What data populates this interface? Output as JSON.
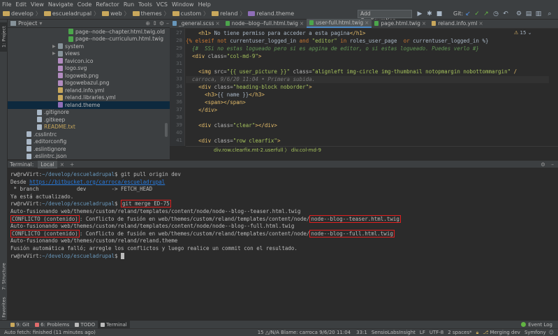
{
  "menu": [
    "File",
    "Edit",
    "View",
    "Navigate",
    "Code",
    "Refactor",
    "Run",
    "Tools",
    "VCS",
    "Window",
    "Help"
  ],
  "breadcrumb": [
    "develop",
    "escueladrupal",
    "web",
    "themes",
    "custom",
    "reland",
    "reland.theme"
  ],
  "toolbar": {
    "add_configuration": "Add Configuration...",
    "git_label": "Git:"
  },
  "project": {
    "header": "Project",
    "tree": [
      {
        "label": "page--node--chapter.html.twig.old",
        "indent": 5,
        "kind": "twig"
      },
      {
        "label": "page--node--curriculum.html.twig",
        "indent": 5,
        "kind": "twig"
      },
      {
        "label": "system",
        "indent": 4,
        "kind": "folder",
        "arrow": "▶"
      },
      {
        "label": "views",
        "indent": 4,
        "kind": "folder",
        "arrow": "▶"
      },
      {
        "label": "favicon.ico",
        "indent": 4,
        "kind": "img"
      },
      {
        "label": "logo.svg",
        "indent": 4,
        "kind": "img"
      },
      {
        "label": "logoweb.png",
        "indent": 4,
        "kind": "img"
      },
      {
        "label": "logowebazul.png",
        "indent": 4,
        "kind": "img"
      },
      {
        "label": "reland.info.yml",
        "indent": 4,
        "kind": "yml"
      },
      {
        "label": "reland.libraries.yml",
        "indent": 4,
        "kind": "yml"
      },
      {
        "label": "reland.theme",
        "indent": 4,
        "kind": "php",
        "selected": true
      },
      {
        "label": ".gitignore",
        "indent": 2,
        "kind": "txt"
      },
      {
        "label": ".gitkeep",
        "indent": 2,
        "kind": "txt"
      },
      {
        "label": "README.txt",
        "indent": 2,
        "kind": "readme"
      },
      {
        "label": ".csslintrc",
        "indent": 1,
        "kind": "txt"
      },
      {
        "label": ".editorconfig",
        "indent": 1,
        "kind": "cfg"
      },
      {
        "label": ".eslintignore",
        "indent": 1,
        "kind": "cfg"
      },
      {
        "label": ".eslintrc.json",
        "indent": 1,
        "kind": "cfg"
      }
    ]
  },
  "tabs": [
    {
      "label": "_general.scss",
      "color": "#6897bb"
    },
    {
      "label": "node--blog--full.html.twig",
      "color": "#4ca64c"
    },
    {
      "label": "user-full.html.twig",
      "color": "#4ca64c",
      "active": true
    },
    {
      "label": "page.html.twig",
      "color": "#4ca64c"
    },
    {
      "label": "reland.info.yml",
      "color": "#c9a85c"
    }
  ],
  "editor": {
    "lines": [
      {
        "n": "27",
        "html": "    <span class='c-tag'>&lt;h1&gt;</span><span class='c-txt'> No tiene permiso para acceder a esta pagina</span><span class='c-tag'>&lt;/h1&gt;</span>"
      },
      {
        "n": "28",
        "html": "<span class='c-kw'>{% elseif not</span><span class='c-txt'> currentuser_logged_in </span><span class='c-kw'>and</span><span class='c-str'> \"editor\"</span><span class='c-kw'> in</span><span class='c-txt'> roles_user_page  </span><span class='c-kw'>or</span><span class='c-txt'> currentuser_logged_in %}</span>"
      },
      {
        "n": "29",
        "html": "  <span class='c-com'>{#  SSi no estas logueado pero si es apgina de editor, o si estas logueado. Puedes verlo #}</span>"
      },
      {
        "n": "30",
        "html": "  <span class='c-tag'>&lt;div </span><span class='c-attr'>class=</span><span class='c-str'>\"col-md-9\"</span><span class='c-tag'>&gt;</span>"
      },
      {
        "n": "31",
        "html": ""
      },
      {
        "n": "32",
        "html": "    <span class='c-tag'>&lt;img </span><span class='c-attr'>src=</span><span class='c-str'>\"{{ user_picture }}\"</span><span class='c-attr'> class=</span><span class='c-str'>\"alignleft img-circle img-thumbnail notopmargin nobottommargin\"</span><span class='c-tag'> /</span>"
      },
      {
        "n": "33",
        "html": "  <span class='c-blame'>carroca, 9/6/20 11:04 • Primera subida.</span>",
        "cur": true
      },
      {
        "n": "34",
        "html": "    <span class='c-tag'>&lt;div </span><span class='c-attr'>class=</span><span class='c-str'>\"heading-block noborder\"</span><span class='c-tag'>&gt;</span>"
      },
      {
        "n": "35",
        "html": "      <span class='c-tag'>&lt;h3&gt;</span><span class='c-txt'>{{ name }}</span><span class='c-tag'>&lt;/h3&gt;</span>"
      },
      {
        "n": "36",
        "html": "      <span class='c-tag'>&lt;span&gt;&lt;/span&gt;</span>"
      },
      {
        "n": "37",
        "html": "    <span class='c-tag'>&lt;/div&gt;</span>"
      },
      {
        "n": "38",
        "html": ""
      },
      {
        "n": "39",
        "html": "    <span class='c-tag'>&lt;div </span><span class='c-attr'>class=</span><span class='c-str'>\"clear\"</span><span class='c-tag'>&gt;&lt;/div&gt;</span>"
      },
      {
        "n": "40",
        "html": ""
      },
      {
        "n": "41",
        "html": "    <span class='c-tag'>&lt;div </span><span class='c-attr'>class=</span><span class='c-str'>\"row clearfix\"</span><span class='c-tag'>&gt;</span>"
      }
    ],
    "inspection": "15 ⌄",
    "breadcrumb": "div.row.clearfix.mt-2.userfull  〉 div.col-md-9"
  },
  "terminal": {
    "title": "Terminal:",
    "tab": "Local",
    "lines": [
      {
        "html": "<span class='prompt'>rw@rwVirt:</span><span class='path'>~/develop/escueladrupal</span><span class='prompt'>$ git pull origin dev</span>"
      },
      {
        "html": "Desde <span class='link'>https://bitbucket.org/carroca/escueladrupal</span>"
      },
      {
        "html": " * branch            dev        -> FETCH_HEAD"
      },
      {
        "html": "Ya está actualizado."
      },
      {
        "html": "<span class='prompt'>rw@rwVirt:</span><span class='path'>~/develop/escueladrupal</span><span class='prompt'>$ <span class='redbox'>git merge ED-75</span></span>"
      },
      {
        "html": "Auto-fusionando web/themes/custom/reland/templates/content/node/node--blog--teaser.html.twig"
      },
      {
        "html": "<span class='redbox'>CONFLICTO (contenido)</span>: Conflicto de fusión en web/themes/custom/reland/templates/content/node/<span class='redbox'>node--blog--teaser.html.twig</span>"
      },
      {
        "html": "Auto-fusionando web/themes/custom/reland/templates/content/node/node--blog--full.html.twig"
      },
      {
        "html": "<span class='redbox'>CONFLICTO (contenido)</span>: Conflicto de fusión en web/themes/custom/reland/templates/content/node/<span class='redbox'>node--blog--full.html.twig</span>"
      },
      {
        "html": "Auto-fusionando web/themes/custom/reland/reland.theme"
      },
      {
        "html": "Fusión automática falló; arregle los conflictos y luego realice un commit con el resultado."
      },
      {
        "html": "<span class='prompt'>rw@rwVirt:</span><span class='path'>~/develop/escueladrupal</span><span class='prompt'>$ </span><span style='background:#bbbbbb;color:#2b2b2b'> </span>"
      }
    ]
  },
  "left_tabs": [
    "1: Project",
    "7: Structure",
    "2: Favorites"
  ],
  "tool_windows": [
    {
      "label": "9: Git",
      "color": "#c9a85c"
    },
    {
      "label": "6: Problems",
      "color": "#e06c6c"
    },
    {
      "label": "TODO",
      "color": "#bbbbbb"
    },
    {
      "label": "Terminal",
      "color": "#bbbbbb",
      "active": true
    }
  ],
  "event_log": "Event Log",
  "status": {
    "message": "Auto fetch: finished (11 minutes ago)",
    "blame": "15 △/N/A  Blame: carroca 9/6/20 11:04",
    "position": "33:1",
    "plugin": "SensioLabsInsight",
    "line_sep": "LF",
    "encoding": "UTF-8",
    "indent": "2 spaces*",
    "branch": "Merging dev",
    "framework": "Symfony"
  }
}
